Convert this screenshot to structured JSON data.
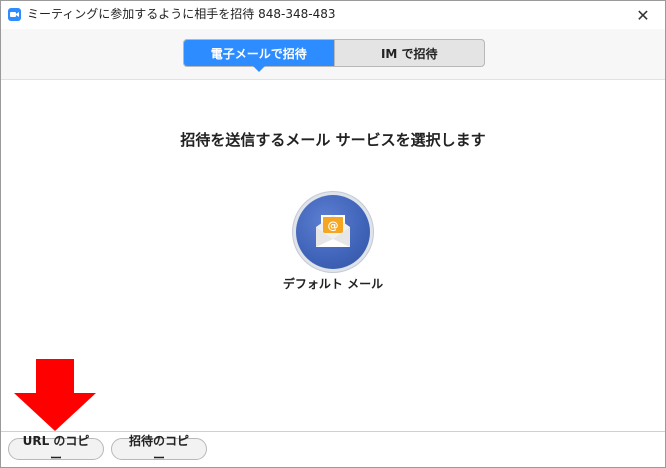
{
  "window": {
    "title": "ミーティングに参加するように相手を招待 848-348-483",
    "close_glyph": "✕"
  },
  "tabs": [
    {
      "label": "電子メールで招待",
      "active": true
    },
    {
      "label": "IM で招待",
      "active": false
    }
  ],
  "main": {
    "heading": "招待を送信するメール サービスを選択します",
    "email_options": [
      {
        "label": "デフォルト メール",
        "icon": "envelope-icon"
      }
    ]
  },
  "footer": {
    "copy_url_label": "URL のコピー",
    "copy_invitation_label": "招待のコピー"
  },
  "annotation": {
    "arrow_icon": "red-down-arrow",
    "arrow_color": "#ff0000"
  },
  "colors": {
    "accent": "#2d8cff",
    "mail_circle": "#3f63b8",
    "envelope_flap": "#f5a623"
  }
}
